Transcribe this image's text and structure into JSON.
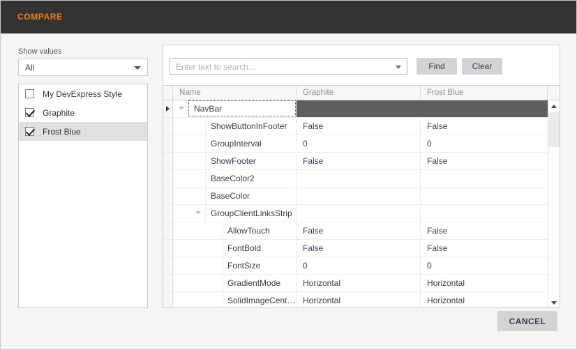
{
  "window": {
    "title": "COMPARE",
    "accent_color": "#f07d15",
    "titlebar_color": "#333333",
    "background_color": "#f5f5f5"
  },
  "left_panel": {
    "show_values_label": "Show values",
    "show_values_selected": "All",
    "show_values_options": [
      "All"
    ],
    "style_list": [
      {
        "label": "My DevExpress Style",
        "checked": false,
        "selected": false
      },
      {
        "label": "Graphite",
        "checked": true,
        "selected": false
      },
      {
        "label": "Frost Blue",
        "checked": true,
        "selected": true
      }
    ]
  },
  "search": {
    "placeholder": "Enter text to search...",
    "value": "",
    "find_label": "Find",
    "clear_label": "Clear"
  },
  "grid": {
    "columns": [
      "Name",
      "Graphite",
      "Frost Blue"
    ],
    "selected_row_color": "#5e5e5e",
    "rows": [
      {
        "name": "NavBar",
        "level": 0,
        "expander": "expanded",
        "graphite": "",
        "frost_blue": "",
        "selected": true,
        "indicator": true
      },
      {
        "name": "ShowButtonInFooter",
        "level": 1,
        "expander": "none",
        "graphite": "False",
        "frost_blue": "False",
        "selected": false,
        "indicator": false
      },
      {
        "name": "GroupInterval",
        "level": 1,
        "expander": "none",
        "graphite": "0",
        "frost_blue": "0",
        "selected": false,
        "indicator": false
      },
      {
        "name": "ShowFooter",
        "level": 1,
        "expander": "none",
        "graphite": "False",
        "frost_blue": "False",
        "selected": false,
        "indicator": false
      },
      {
        "name": "BaseColor2",
        "level": 1,
        "expander": "none",
        "graphite": "",
        "frost_blue": "",
        "selected": false,
        "indicator": false
      },
      {
        "name": "BaseColor",
        "level": 1,
        "expander": "none",
        "graphite": "",
        "frost_blue": "",
        "selected": false,
        "indicator": false
      },
      {
        "name": "GroupClientLinksStrip",
        "level": 1,
        "expander": "expanded",
        "graphite": "",
        "frost_blue": "",
        "selected": false,
        "indicator": false
      },
      {
        "name": "AllowTouch",
        "level": 2,
        "expander": "none",
        "graphite": "False",
        "frost_blue": "False",
        "selected": false,
        "indicator": false
      },
      {
        "name": "FontBold",
        "level": 2,
        "expander": "none",
        "graphite": "False",
        "frost_blue": "False",
        "selected": false,
        "indicator": false
      },
      {
        "name": "FontSize",
        "level": 2,
        "expander": "none",
        "graphite": "0",
        "frost_blue": "0",
        "selected": false,
        "indicator": false
      },
      {
        "name": "GradientMode",
        "level": 2,
        "expander": "none",
        "graphite": "Horizontal",
        "frost_blue": "Horizontal",
        "selected": false,
        "indicator": false
      },
      {
        "name": "SolidImageCenterG...",
        "level": 2,
        "expander": "none",
        "graphite": "Horizontal",
        "frost_blue": "Horizontal",
        "selected": false,
        "indicator": false
      }
    ]
  },
  "footer": {
    "cancel_label": "CANCEL"
  }
}
